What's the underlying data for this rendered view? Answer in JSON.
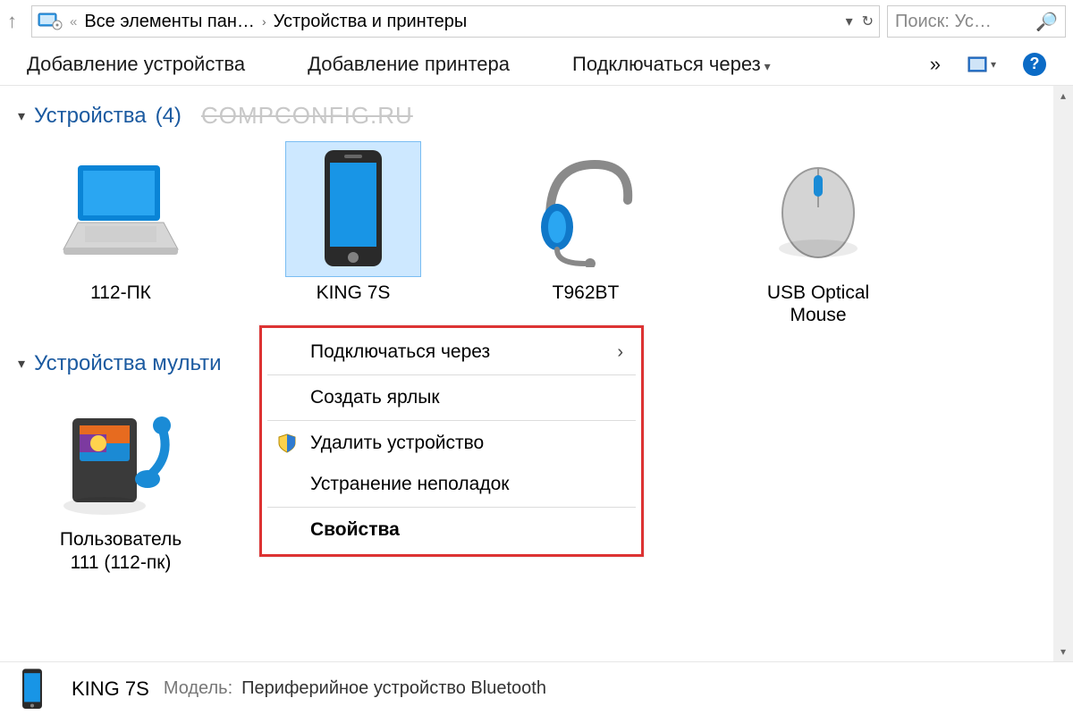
{
  "addressbar": {
    "back_icon": "←",
    "fwd_icon": "→",
    "up_icon": "↑",
    "breadcrumb_prefix": "«",
    "crumb1": "Все элементы пан…",
    "crumb2": "Устройства и принтеры",
    "chevron": "›",
    "refresh_icon": "↻"
  },
  "search": {
    "placeholder": "Поиск: Ус…",
    "icon": "🔍"
  },
  "commandbar": {
    "add_device": "Добавление устройства",
    "add_printer": "Добавление принтера",
    "connect_via": "Подключаться через",
    "overflow": "»",
    "view_icon": "▣",
    "help": "?"
  },
  "groups": {
    "devices": {
      "label": "Устройства",
      "count": "(4)",
      "watermark": "COMPCONFIG.RU"
    },
    "multimedia": {
      "label": "Устройства мульти"
    }
  },
  "devices": [
    {
      "name": "112-ПК",
      "selected": false,
      "icon": "laptop"
    },
    {
      "name": "KING 7S",
      "selected": true,
      "icon": "phone"
    },
    {
      "name": "T962BT",
      "selected": false,
      "icon": "headset"
    },
    {
      "name": "USB Optical Mouse",
      "selected": false,
      "icon": "mouse"
    }
  ],
  "multimedia": [
    {
      "name": "Пользователь 111 (112-пк)",
      "icon": "media-server"
    }
  ],
  "context_menu": {
    "connect_via": "Подключаться через",
    "create_shortcut": "Создать ярлык",
    "remove_device": "Удалить устройство",
    "troubleshoot": "Устранение неполадок",
    "properties": "Свойства"
  },
  "details": {
    "name": "KING 7S",
    "model_label": "Модель:",
    "model_value": "Периферийное устройство Bluetooth"
  }
}
